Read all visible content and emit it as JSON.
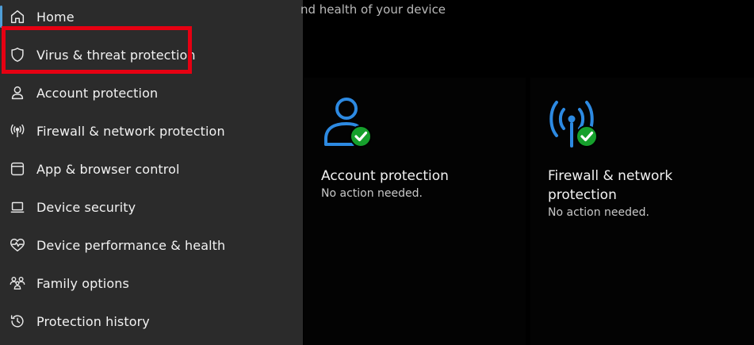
{
  "sidebar": {
    "items": [
      {
        "label": "Home",
        "icon": "home-icon"
      },
      {
        "label": "Virus & threat protection",
        "icon": "shield-icon"
      },
      {
        "label": "Account protection",
        "icon": "person-icon"
      },
      {
        "label": "Firewall & network protection",
        "icon": "antenna-icon"
      },
      {
        "label": "App & browser control",
        "icon": "app-window-icon"
      },
      {
        "label": "Device security",
        "icon": "laptop-icon"
      },
      {
        "label": "Device performance & health",
        "icon": "heart-pulse-icon"
      },
      {
        "label": "Family options",
        "icon": "family-icon"
      },
      {
        "label": "Protection history",
        "icon": "history-icon"
      }
    ]
  },
  "main": {
    "subtitle": "nd health of your device",
    "cards": [
      {
        "title": "Account protection",
        "status": "No action needed.",
        "icon": "account-check-icon"
      },
      {
        "title_line1": "Firewall & network",
        "title_line2": "protection",
        "status": "No action needed.",
        "icon": "antenna-check-icon"
      }
    ]
  },
  "colors": {
    "sidebar_bg": "#2b2b2b",
    "accent": "#4f9ed8",
    "icon_blue": "#2d8ae2",
    "check_green": "#16a02c",
    "highlight_red": "#e60012"
  }
}
